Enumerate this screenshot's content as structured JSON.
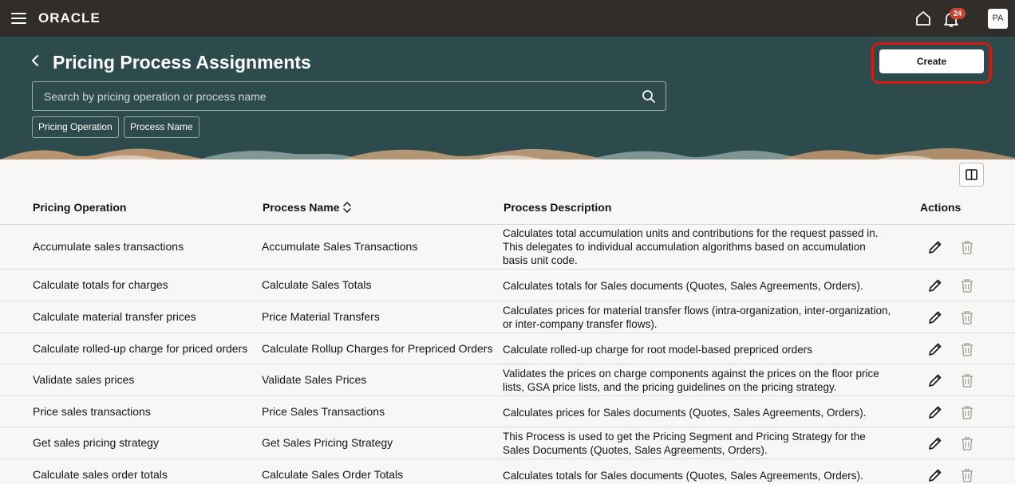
{
  "topbar": {
    "logo": "ORACLE",
    "notifications_count": "24",
    "avatar_initials": "PA",
    "bg_color": "#312d2a"
  },
  "header": {
    "title": "Pricing Process Assignments",
    "search_placeholder": "Search by pricing operation or process name",
    "filter_chips": [
      "Pricing Operation",
      "Process Name"
    ],
    "create_label": "Create",
    "bg_color": "#2d4a4c"
  },
  "table": {
    "columns": {
      "operation": "Pricing Operation",
      "process": "Process Name",
      "description": "Process Description",
      "actions": "Actions"
    },
    "rows": [
      {
        "operation": "Accumulate sales transactions",
        "process": "Accumulate Sales Transactions",
        "description": "Calculates total accumulation units and contributions for the request passed in. This delegates to individual accumulation algorithms based on accumulation basis unit code."
      },
      {
        "operation": "Calculate totals for charges",
        "process": "Calculate Sales Totals",
        "description": "Calculates totals for Sales documents (Quotes, Sales Agreements, Orders)."
      },
      {
        "operation": "Calculate material transfer prices",
        "process": "Price Material Transfers",
        "description": "Calculates prices for material transfer flows (intra-organization, inter-organization, or inter-company transfer flows)."
      },
      {
        "operation": "Calculate rolled-up charge for priced orders",
        "process": "Calculate Rollup Charges for Prepriced Orders",
        "description": "Calculate rolled-up charge for root model-based prepriced orders"
      },
      {
        "operation": "Validate sales prices",
        "process": "Validate Sales Prices",
        "description": "Validates the prices on charge components against the prices on the floor price lists, GSA price lists, and the pricing guidelines on the pricing strategy."
      },
      {
        "operation": "Price sales transactions",
        "process": "Price Sales Transactions",
        "description": "Calculates prices for Sales documents (Quotes, Sales Agreements, Orders)."
      },
      {
        "operation": "Get sales pricing strategy",
        "process": "Get Sales Pricing Strategy",
        "description": "This Process is used to get the Pricing Segment and Pricing Strategy for the Sales Documents (Quotes, Sales Agreements, Orders)."
      },
      {
        "operation": "Calculate sales order totals",
        "process": "Calculate Sales Order Totals",
        "description": "Calculates totals for Sales documents (Quotes, Sales Agreements, Orders)."
      }
    ]
  }
}
